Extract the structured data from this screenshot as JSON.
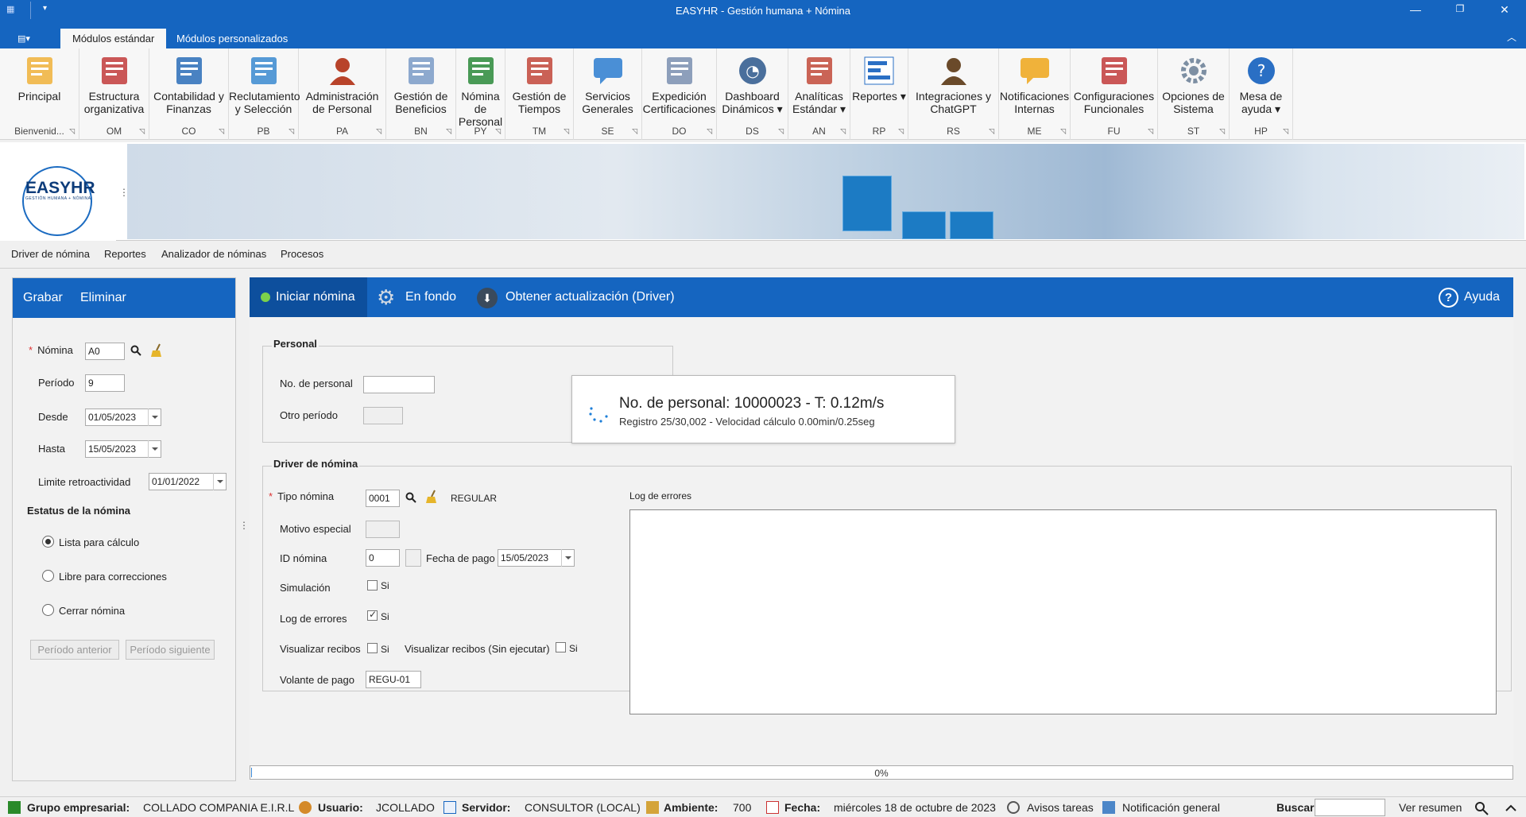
{
  "window": {
    "title": "EASYHR - Gestión humana + Nómina"
  },
  "ribbon_tabs": [
    "Módulos estándar",
    "Módulos personalizados"
  ],
  "ribbon_groups": [
    {
      "label": "Principal",
      "code": "Bienvenid...",
      "icon": "folder-icon"
    },
    {
      "label": "Estructura organizativa",
      "code": "OM",
      "icon": "org-structure-icon"
    },
    {
      "label": "Contabilidad y Finanzas",
      "code": "CO",
      "icon": "accounting-book-icon"
    },
    {
      "label": "Reclutamiento y Selección",
      "code": "PB",
      "icon": "magnifier-icon"
    },
    {
      "label": "Administración de Personal",
      "code": "PA",
      "icon": "person-icon"
    },
    {
      "label": "Gestión de Beneficios",
      "code": "BN",
      "icon": "calculator-icon"
    },
    {
      "label": "Nómina de Personal",
      "code": "PY",
      "icon": "payroll-money-icon"
    },
    {
      "label": "Gestión de Tiempos",
      "code": "TM",
      "icon": "calendar-clock-icon"
    },
    {
      "label": "Servicios Generales",
      "code": "SE",
      "icon": "chat-bubble-icon"
    },
    {
      "label": "Expedición Certificaciones",
      "code": "DO",
      "icon": "document-icon"
    },
    {
      "label": "Dashboard Dinámicos ▾",
      "code": "DS",
      "icon": "gauge-icon"
    },
    {
      "label": "Analíticas Estándar ▾",
      "code": "AN",
      "icon": "analytics-chart-icon"
    },
    {
      "label": "Reportes ▾",
      "code": "RP",
      "icon": "report-bars-icon"
    },
    {
      "label": "Integraciones y ChatGPT",
      "code": "RS",
      "icon": "ai-head-icon"
    },
    {
      "label": "Notificaciones Internas",
      "code": "ME",
      "icon": "notification-bubble-icon"
    },
    {
      "label": "Configuraciones Funcionales",
      "code": "FU",
      "icon": "config-box-icon"
    },
    {
      "label": "Opciones de Sistema",
      "code": "ST",
      "icon": "gear-icon"
    },
    {
      "label": "Mesa de ayuda ▾",
      "code": "HP",
      "icon": "help-icon"
    }
  ],
  "logo": {
    "name": "EASYHR",
    "tagline": "GESTIÓN HUMANA + NÓMINA"
  },
  "subtabs": [
    "Driver de nómina",
    "Reportes",
    "Analizador de nóminas",
    "Procesos"
  ],
  "left": {
    "save": "Grabar",
    "delete": "Eliminar",
    "nomina_label": "Nómina",
    "nomina_value": "A0",
    "periodo_label": "Período",
    "periodo_value": "9",
    "desde_label": "Desde",
    "desde_value": "01/05/2023",
    "hasta_label": "Hasta",
    "hasta_value": "15/05/2023",
    "retro_label": "Limite retroactividad",
    "retro_value": "01/01/2022",
    "status_title": "Estatus de la nómina",
    "status_options": [
      "Lista para cálculo",
      "Libre para correcciones",
      "Cerrar nómina"
    ],
    "prev": "Período anterior",
    "next": "Período siguiente"
  },
  "toolbar": {
    "start": "Iniciar nómina",
    "background": "En fondo",
    "update": "Obtener actualización (Driver)",
    "help": "Ayuda"
  },
  "personal": {
    "title": "Personal",
    "no_label": "No. de personal",
    "no_value": "",
    "other_label": "Otro período"
  },
  "popup": {
    "line1": "No. de personal: 10000023 - T: 0.12m/s",
    "line2": "Registro 25/30,002 - Velocidad cálculo 0.00min/0.25seg"
  },
  "driver": {
    "title": "Driver de nómina",
    "tipo_label": "Tipo nómina",
    "tipo_value": "0001",
    "tipo_desc": "REGULAR",
    "motivo_label": "Motivo especial",
    "id_label": "ID nómina",
    "id_value": "0",
    "fecha_label": "Fecha de pago",
    "fecha_value": "15/05/2023",
    "sim_label": "Simulación",
    "log_label": "Log de errores",
    "vis_label": "Visualizar recibos",
    "vis2_label": "Visualizar recibos (Sin ejecutar)",
    "si": "Si",
    "volante_label": "Volante de pago",
    "volante_value": "REGU-01",
    "log_title": "Log de errores"
  },
  "progress": {
    "text": "0%",
    "value": 0
  },
  "status": {
    "grupo_label": "Grupo empresarial:",
    "grupo_value": "COLLADO  COMPANIA E.I.R.L",
    "usuario_label": "Usuario:",
    "usuario_value": "JCOLLADO",
    "servidor_label": "Servidor:",
    "servidor_value": "CONSULTOR (LOCAL)",
    "ambiente_label": "Ambiente:",
    "ambiente_value": "700",
    "fecha_label": "Fecha:",
    "fecha_value": "miércoles 18 de octubre de 2023",
    "avisos": "Avisos tareas",
    "notif": "Notificación general",
    "buscar": "Buscar",
    "resumen": "Ver resumen"
  }
}
